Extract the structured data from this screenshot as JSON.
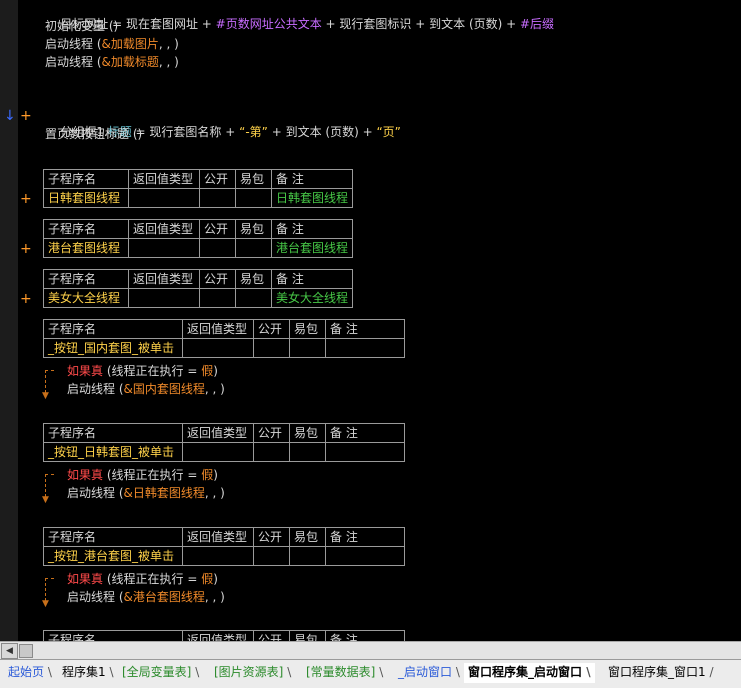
{
  "code": {
    "line1": {
      "a": "目标网址",
      "b": " = ",
      "c": "现在套图网址",
      "d": " + ",
      "e": "#页数网址公共文本",
      "f": " + ",
      "g": "现行套图标识",
      "h": " + ",
      "i": "到文本 (页数)",
      "j": " + ",
      "k": "#后缀"
    },
    "line2": {
      "a": "初始化变量 ()"
    },
    "line3": {
      "a": "启动线程 (",
      "b": "&加载图片",
      "c": ", , )"
    },
    "line4": {
      "a": "启动线程 (",
      "b": "&加载标题",
      "c": ", , )"
    },
    "line5": {
      "a": "分组框1.",
      "b": "标题",
      "c": " = ",
      "d": "现行套图名称",
      "e": " + ",
      "f": "“-第”",
      "g": " + ",
      "h": "到文本 (页数)",
      "i": " + ",
      "j": "“页”"
    },
    "line6": {
      "a": "置页数按钮标题 ()"
    }
  },
  "headers": {
    "name": "子程序名",
    "ret": "返回值类型",
    "pub": "公开",
    "easy": "易包",
    "note": "备 注"
  },
  "subs_collapsed": [
    {
      "name": "日韩套图线程",
      "note": "日韩套图线程"
    },
    {
      "name": "港台套图线程",
      "note": "港台套图线程"
    },
    {
      "name": "美女大全线程",
      "note": "美女大全线程"
    }
  ],
  "subs_expanded": [
    {
      "name": "_按钮_国内套图_被单击",
      "if_kw": "如果真",
      "if_cond": " (线程正在执行 = ",
      "if_val": "假",
      "if_end": ")",
      "start": "启动线程 (",
      "thread": "&国内套图线程",
      "end": ", , )"
    },
    {
      "name": "_按钮_日韩套图_被单击",
      "if_kw": "如果真",
      "if_cond": " (线程正在执行 = ",
      "if_val": "假",
      "if_end": ")",
      "start": "启动线程 (",
      "thread": "&日韩套图线程",
      "end": ", , )"
    },
    {
      "name": "_按钮_港台套图_被单击",
      "if_kw": "如果真",
      "if_cond": " (线程正在执行 = ",
      "if_val": "假",
      "if_end": ")",
      "start": "启动线程 (",
      "thread": "&港台套图线程",
      "end": ", , )"
    }
  ],
  "tabs": [
    {
      "label": "起始页"
    },
    {
      "label": "程序集1"
    },
    {
      "label": "[全局变量表]"
    },
    {
      "label": "[图片资源表]"
    },
    {
      "label": "[常量数据表]"
    },
    {
      "label": "_启动窗口"
    },
    {
      "label": "窗口程序集_启动窗口"
    },
    {
      "label": "窗口程序集_窗口1"
    }
  ],
  "colors": {
    "background": "#000000",
    "keyword": "#ffd24a",
    "flow": "#ff4a4a",
    "note": "#47c847",
    "constant": "#c86cff",
    "pointer": "#f08a2a"
  },
  "icons": {
    "expand": "plus-icon",
    "bookmark": "down-arrow-icon",
    "scroll_left": "left-arrow-icon"
  }
}
